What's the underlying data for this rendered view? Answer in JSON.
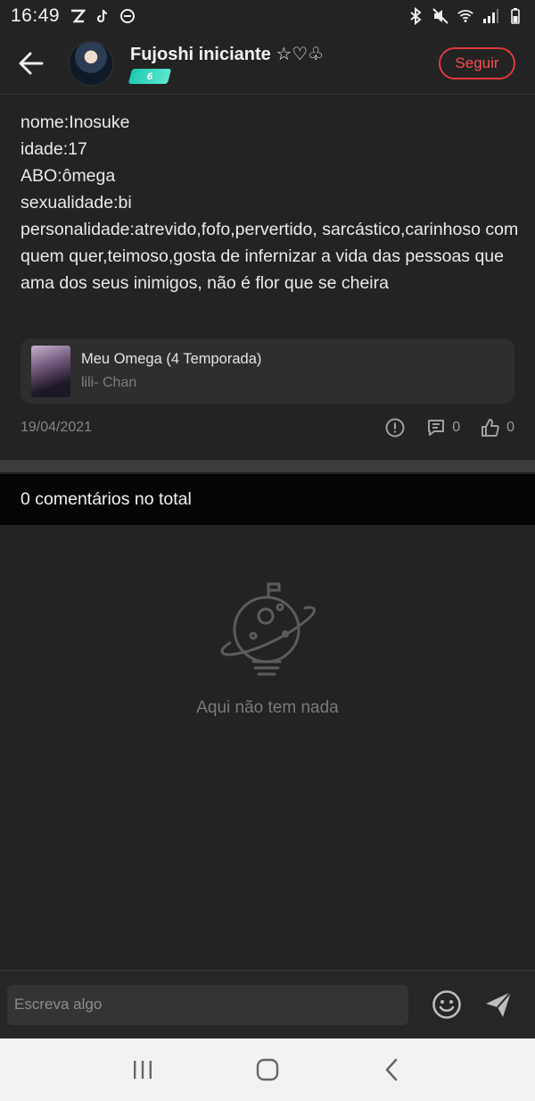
{
  "status_bar": {
    "time": "16:49"
  },
  "header": {
    "author_name": "Fujoshi iniciante ☆♡♧",
    "level": "6",
    "follow_label": "Seguir"
  },
  "post": {
    "lines": [
      "nome:Inosuke",
      "idade:17",
      "ABO:ômega",
      "sexualidade:bi",
      "personalidade:atrevido,fofo,pervertido, sarcástico,carinhoso com quem quer,teimoso,gosta de infernizar a vida das pessoas que ama dos seus inimigos, não é flor que se cheira"
    ],
    "book": {
      "title": "Meu Omega (4 Temporada)",
      "author": "lili- Chan"
    },
    "date": "19/04/2021",
    "comment_count": "0",
    "like_count": "0"
  },
  "comments": {
    "header": "0 comentários no total",
    "empty_text": "Aqui não tem nada"
  },
  "composer": {
    "placeholder": "Escreva algo"
  },
  "colors": {
    "accent": "#e0383c",
    "badge": "#1ecbb0",
    "background": "#232323"
  }
}
